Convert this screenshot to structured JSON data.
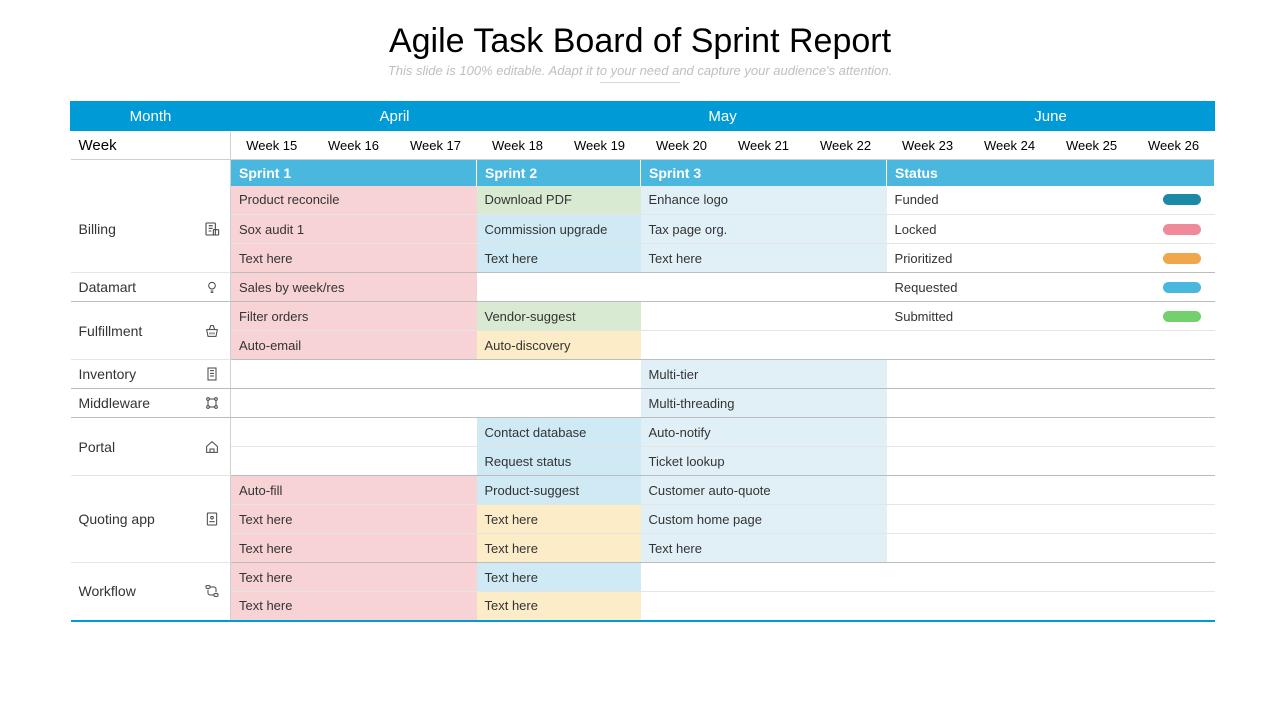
{
  "title": "Agile Task Board of Sprint Report",
  "subtitle": "This slide is 100% editable. Adapt it to your need and capture your audience's attention.",
  "headers": {
    "month_label": "Month",
    "months": [
      "April",
      "May",
      "June"
    ],
    "week_label": "Week",
    "weeks": [
      "Week 15",
      "Week 16",
      "Week 17",
      "Week 18",
      "Week 19",
      "Week 20",
      "Week 21",
      "Week 22",
      "Week 23",
      "Week 24",
      "Week 25",
      "Week 26"
    ],
    "sprints": [
      "Sprint 1",
      "Sprint 2",
      "Sprint 3",
      "Status"
    ]
  },
  "rows": {
    "billing": {
      "label": "Billing",
      "r1": {
        "s1": "Product reconcile",
        "s2": "Download PDF",
        "s3": "Enhance logo",
        "status": "Funded"
      },
      "r2": {
        "s1": "Sox audit 1",
        "s2": "Commission upgrade",
        "s3": "Tax page org.",
        "status": "Locked"
      },
      "r3": {
        "s1": "Text here",
        "s2": "Text here",
        "s3": "Text here",
        "status": "Prioritized"
      }
    },
    "datamart": {
      "label": "Datamart",
      "r1": {
        "s1": "Sales by week/res",
        "status": "Requested"
      }
    },
    "fulfillment": {
      "label": "Fulfillment",
      "r1": {
        "s1": "Filter orders",
        "s2": "Vendor-suggest",
        "status": "Submitted"
      },
      "r2": {
        "s1": "Auto-email",
        "s2": "Auto-discovery"
      }
    },
    "inventory": {
      "label": "Inventory",
      "r1": {
        "s3": "Multi-tier"
      }
    },
    "middleware": {
      "label": "Middleware",
      "r1": {
        "s3": "Multi-threading"
      }
    },
    "portal": {
      "label": "Portal",
      "r1": {
        "s2": "Contact database",
        "s3": "Auto-notify"
      },
      "r2": {
        "s2": "Request status",
        "s3": "Ticket lookup"
      }
    },
    "quoting": {
      "label": "Quoting app",
      "r1": {
        "s1": "Auto-fill",
        "s2": "Product-suggest",
        "s3": "Customer auto-quote"
      },
      "r2": {
        "s1": "Text here",
        "s2": "Text here",
        "s3": "Custom home page"
      },
      "r3": {
        "s1": "Text here",
        "s2": "Text here",
        "s3": "Text here"
      }
    },
    "workflow": {
      "label": "Workflow",
      "r1": {
        "s1": "Text here",
        "s2": "Text here"
      },
      "r2": {
        "s1": "Text here",
        "s2": "Text here"
      }
    }
  }
}
